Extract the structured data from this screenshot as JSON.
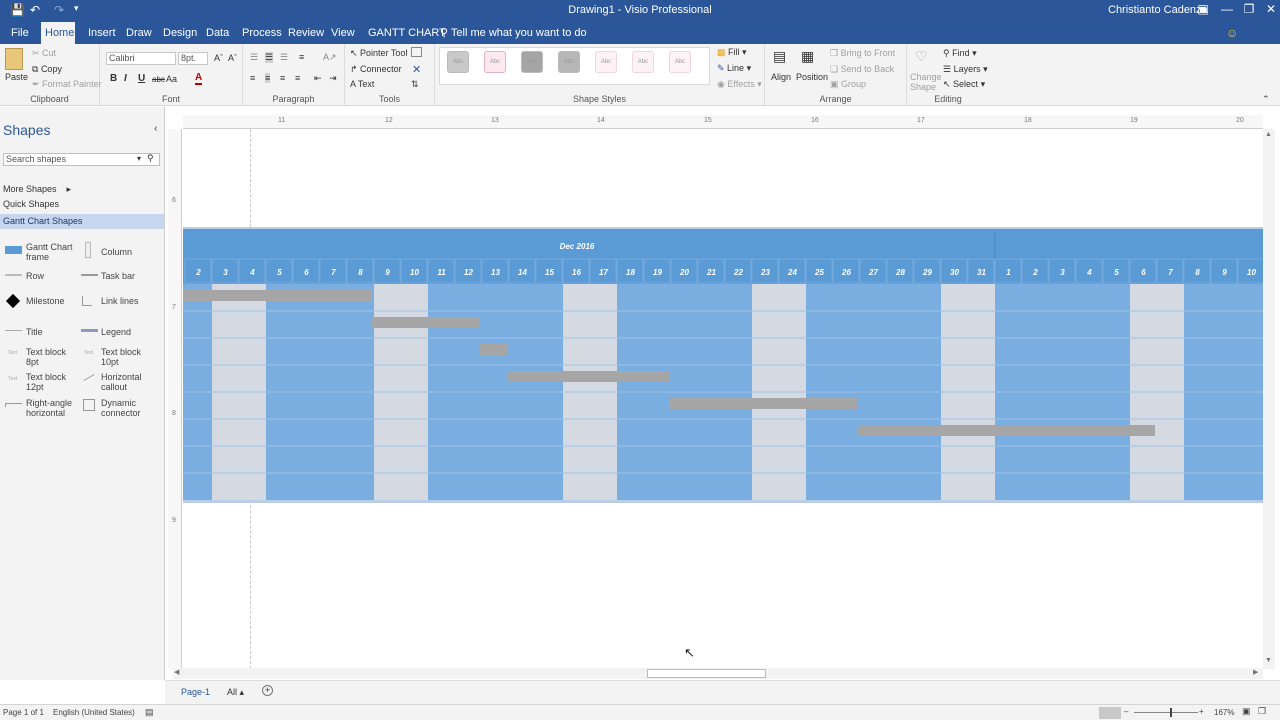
{
  "window": {
    "title": "Drawing1  -  Visio Professional",
    "user": "Christianto Cadenza"
  },
  "qat": {
    "save_icon": "save-icon",
    "undo_icon": "undo-icon",
    "redo_icon": "redo-icon",
    "customize_icon": "customize-qat-icon"
  },
  "tabs": [
    "File",
    "Home",
    "Insert",
    "Draw",
    "Design",
    "Data",
    "Process",
    "Review",
    "View",
    "GANTT CHART"
  ],
  "active_tab": "Home",
  "tell_me": "Tell me what you want to do",
  "ribbon": {
    "clipboard": {
      "paste": "Paste",
      "cut": "Cut",
      "copy": "Copy",
      "format_painter": "Format Painter",
      "label": "Clipboard"
    },
    "font": {
      "family": "Calibri",
      "size": "8pt.",
      "label": "Font",
      "bold": "B",
      "italic": "I",
      "underline": "U",
      "strike": "abc",
      "case": "Aa",
      "color": "A"
    },
    "paragraph": {
      "label": "Paragraph"
    },
    "tools": {
      "pointer": "Pointer Tool",
      "connector": "Connector",
      "text": "Text",
      "label": "Tools"
    },
    "shape_styles": {
      "label": "Shape Styles",
      "preview": [
        "Abc",
        "Abc",
        "Abc",
        "Abc",
        "Abc",
        "Abc",
        "Abc"
      ],
      "fill": "Fill",
      "line": "Line",
      "effects": "Effects"
    },
    "arrange": {
      "align": "Align",
      "position": "Position",
      "bring_front": "Bring to Front",
      "send_back": "Send to Back",
      "group": "Group",
      "label": "Arrange"
    },
    "editing": {
      "change_shape": "Change Shape",
      "find": "Find",
      "layers": "Layers",
      "select": "Select",
      "label": "Editing"
    }
  },
  "sidebar": {
    "title": "Shapes",
    "search_placeholder": "Search shapes",
    "more_shapes": "More Shapes",
    "quick_shapes": "Quick Shapes",
    "gantt_shapes": "Gantt Chart Shapes",
    "stencils": [
      {
        "label": "Gantt Chart frame",
        "icon": "gantt-frame-icon"
      },
      {
        "label": "Column",
        "icon": "column-icon"
      },
      {
        "label": "Row",
        "icon": "row-icon"
      },
      {
        "label": "Task bar",
        "icon": "task-bar-icon"
      },
      {
        "label": "Milestone",
        "icon": "milestone-icon"
      },
      {
        "label": "Link lines",
        "icon": "link-lines-icon"
      },
      {
        "label": "Title",
        "icon": "title-icon"
      },
      {
        "label": "Legend",
        "icon": "legend-icon"
      },
      {
        "label": "Text block 8pt",
        "icon": "text-block-icon"
      },
      {
        "label": "Text block 10pt",
        "icon": "text-block-icon"
      },
      {
        "label": "Text block 12pt",
        "icon": "text-block-icon"
      },
      {
        "label": "Horizontal callout",
        "icon": "callout-icon"
      },
      {
        "label": "Right-angle horizontal",
        "icon": "right-angle-icon"
      },
      {
        "label": "Dynamic connector",
        "icon": "dynamic-connector-icon"
      }
    ]
  },
  "ruler": {
    "h": [
      "11",
      "12",
      "13",
      "14",
      "15",
      "16",
      "17",
      "18",
      "19",
      "20"
    ],
    "v": [
      "6",
      "7",
      "8",
      "9"
    ]
  },
  "gantt": {
    "month": "Dec 2016",
    "days": [
      "2",
      "3",
      "4",
      "5",
      "6",
      "7",
      "8",
      "9",
      "10",
      "11",
      "12",
      "13",
      "14",
      "15",
      "16",
      "17",
      "18",
      "19",
      "20",
      "21",
      "22",
      "23",
      "24",
      "25",
      "26",
      "27",
      "28",
      "29",
      "30",
      "31",
      "1",
      "2",
      "3",
      "4",
      "5",
      "6",
      "7",
      "8",
      "9",
      "10"
    ],
    "weekend_index": [
      1,
      2,
      7,
      8,
      14,
      15,
      21,
      22,
      28,
      29,
      35,
      36
    ],
    "rows": 8,
    "tasks": [
      {
        "start": 0,
        "end": 7
      },
      {
        "start": 7,
        "end": 11
      },
      {
        "start": 11,
        "end": 12
      },
      {
        "start": 12,
        "end": 18
      },
      {
        "start": 18,
        "end": 25
      },
      {
        "start": 25,
        "end": 36
      }
    ],
    "colors": {
      "header": "#5b9bd5",
      "body": "#7aaee0",
      "weekend": "#d5d9e2",
      "bar": "#a6a6a6",
      "gridline": "#9ec3ea"
    }
  },
  "page_tabs": {
    "page": "Page-1",
    "all": "All"
  },
  "status": {
    "page": "Page 1 of 1",
    "language": "English (United States)",
    "zoom": "167%"
  }
}
